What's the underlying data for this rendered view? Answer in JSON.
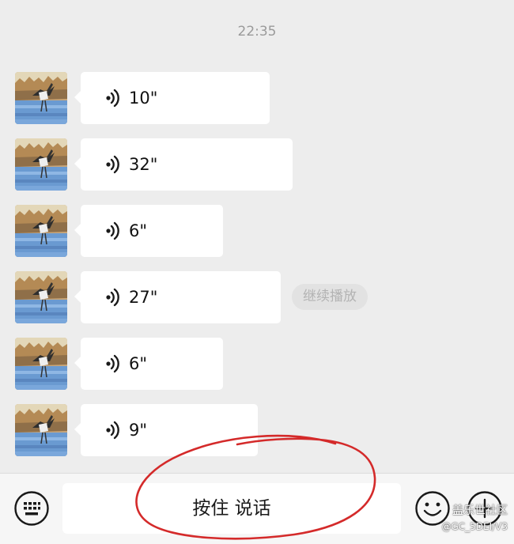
{
  "chat": {
    "timestamp": "22:35",
    "messages": [
      {
        "duration": "10\""
      },
      {
        "duration": "32\""
      },
      {
        "duration": "6\""
      },
      {
        "duration": "27\""
      },
      {
        "duration": "6\""
      },
      {
        "duration": "9\""
      }
    ],
    "continue_play_label": "继续播放"
  },
  "input_bar": {
    "talk_label": "按住 说话",
    "left_icon": "keyboard-icon",
    "right_icons": [
      "emoji-icon",
      "plus-icon"
    ]
  },
  "watermark": {
    "line1": "盖乐世社区",
    "line2": "@GC_5DEI/V3"
  },
  "colors": {
    "background": "#ededed",
    "bubble": "#ffffff",
    "annotation": "#d42a2a",
    "continue_play": "#e2e2e2"
  }
}
